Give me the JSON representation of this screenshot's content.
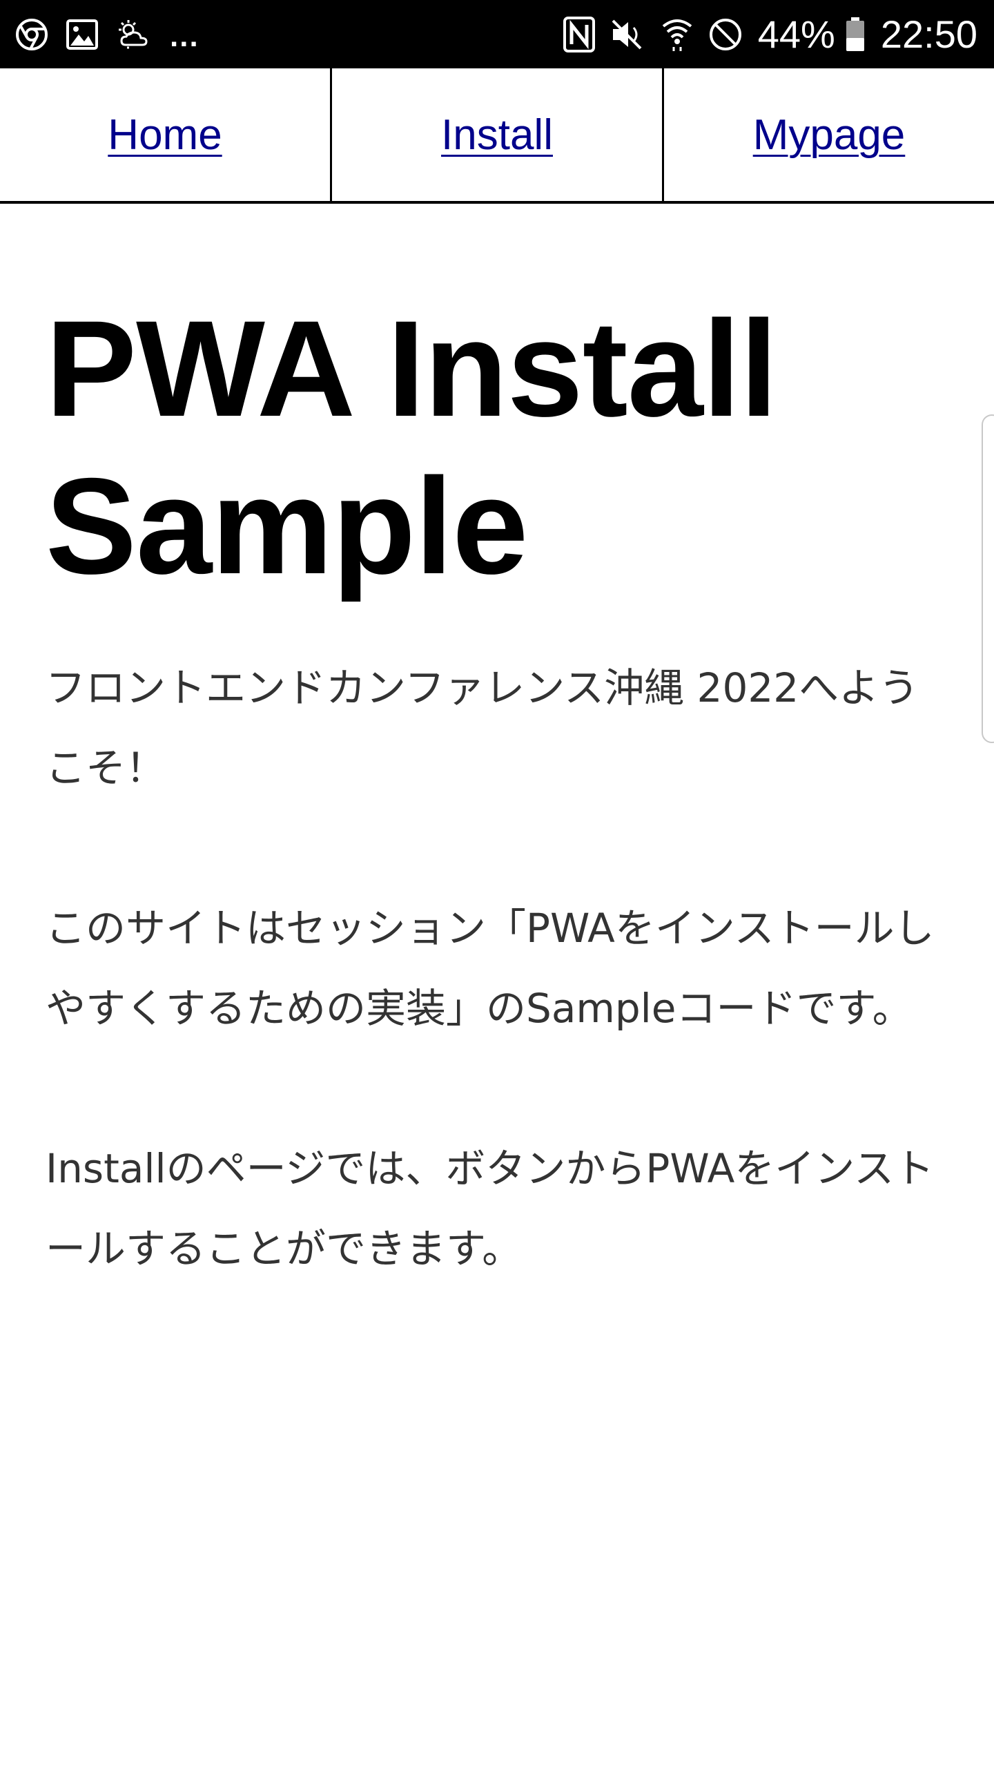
{
  "status_bar": {
    "left_icons": [
      "chrome-icon",
      "gallery-icon",
      "weather-icon"
    ],
    "more_indicator": "...",
    "right_icons": [
      "nfc-icon",
      "mute-icon",
      "wifi-icon",
      "do-not-disturb-icon",
      "battery-icon"
    ],
    "battery_percent": "44%",
    "battery_level": 0.44,
    "time": "22:50"
  },
  "nav": {
    "items": [
      {
        "label": "Home"
      },
      {
        "label": "Install"
      },
      {
        "label": "Mypage"
      }
    ],
    "link_color": "#00008b"
  },
  "main": {
    "title_line1": "PWA Install",
    "title_line2": "Sample",
    "intro": "フロントエンドカンファレンス沖縄 2022へようこそ！",
    "paragraph1": "このサイトはセッション「PWAをインストールしやすくするための実装」のSampleコードです。",
    "paragraph2": "Installのページでは、ボタンからPWAをインストールすることができます。"
  }
}
